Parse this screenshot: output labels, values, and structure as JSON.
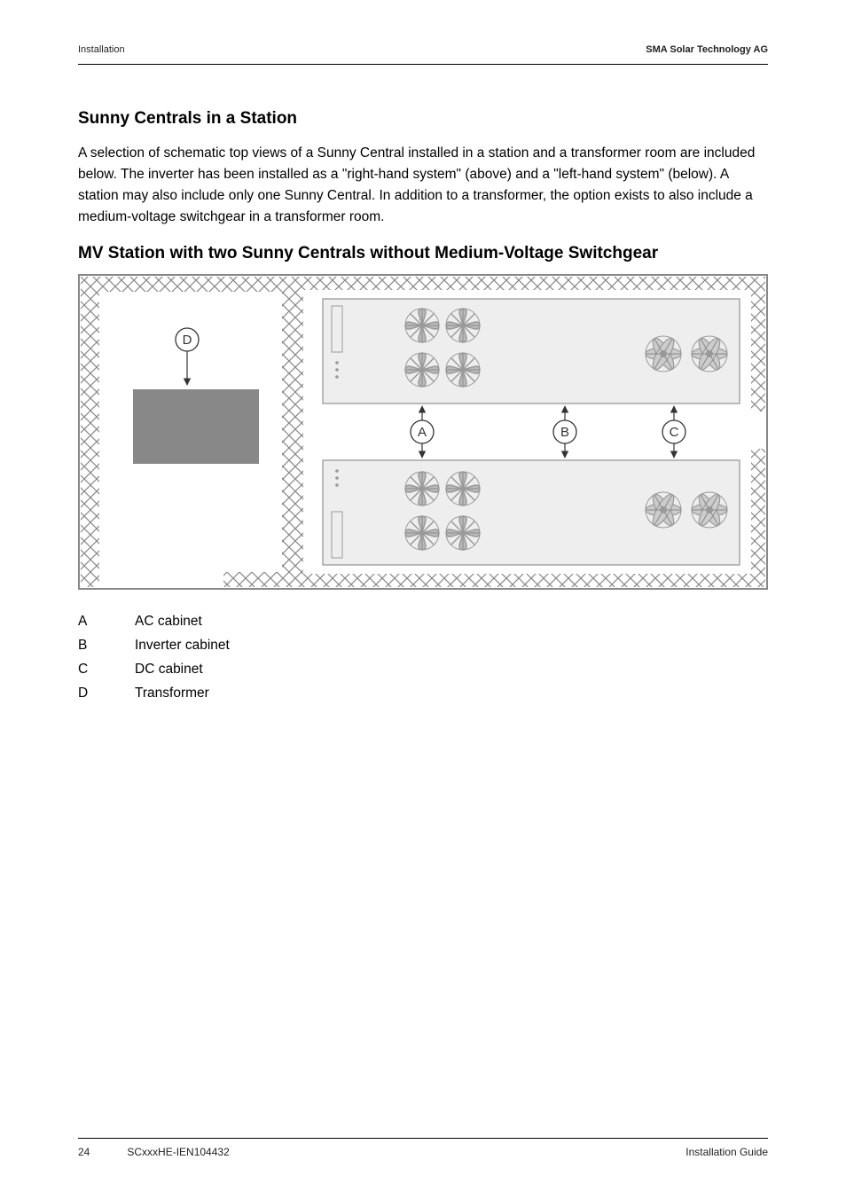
{
  "header": {
    "left": "Installation",
    "right": "SMA Solar Technology AG"
  },
  "section": {
    "title": "Sunny Centrals in a Station",
    "para": "A selection of schematic top views of a Sunny Central installed in a station and a transformer room are included below. The inverter has been installed as a \"right-hand system\" (above) and a \"left-hand system\" (below). A station may also include only one Sunny Central. In addition to a transformer, the option exists to also include a medium-voltage switchgear in a transformer room.",
    "subtitle": "MV Station with two Sunny Centrals without Medium-Voltage Switchgear"
  },
  "diagram": {
    "labels": {
      "A": "A",
      "B": "B",
      "C": "C",
      "D": "D"
    }
  },
  "legend": [
    {
      "key": "A",
      "label": "AC cabinet"
    },
    {
      "key": "B",
      "label": "Inverter cabinet"
    },
    {
      "key": "C",
      "label": "DC cabinet"
    },
    {
      "key": "D",
      "label": "Transformer"
    }
  ],
  "footer": {
    "page": "24",
    "doc": "SCxxxHE-IEN104432",
    "right": "Installation Guide"
  }
}
